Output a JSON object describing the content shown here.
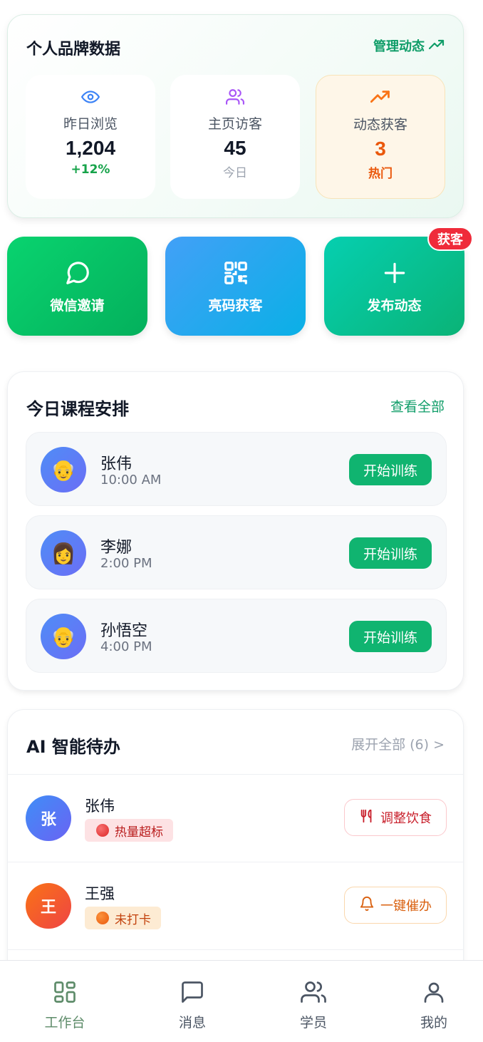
{
  "brand": {
    "title": "个人品牌数据",
    "manage_link": "管理动态",
    "stats": [
      {
        "label": "昨日浏览",
        "value": "1,204",
        "sub": "+12%",
        "icon": "eye-icon"
      },
      {
        "label": "主页访客",
        "value": "45",
        "sub": "今日",
        "icon": "users-icon"
      },
      {
        "label": "动态获客",
        "value": "3",
        "sub": "热门",
        "icon": "trending-up-icon"
      }
    ]
  },
  "actions": [
    {
      "label": "微信邀请",
      "icon": "chat-bubble-icon"
    },
    {
      "label": "亮码获客",
      "icon": "qr-code-icon"
    },
    {
      "label": "发布动态",
      "icon": "plus-icon",
      "badge": "获客"
    }
  ],
  "courses": {
    "title": "今日课程安排",
    "view_all": "查看全部",
    "items": [
      {
        "name": "张伟",
        "time": "10:00 AM",
        "avatar": "👴",
        "button": "开始训练"
      },
      {
        "name": "李娜",
        "time": "2:00 PM",
        "avatar": "👩",
        "button": "开始训练"
      },
      {
        "name": "孙悟空",
        "time": "4:00 PM",
        "avatar": "👴",
        "button": "开始训练"
      }
    ]
  },
  "todos": {
    "title": "AI 智能待办",
    "expand": "展开全部 (6) >",
    "items": [
      {
        "initial": "张",
        "name": "张伟",
        "tag": "热量超标",
        "action": "调整饮食",
        "action_icon": "utensils-icon"
      },
      {
        "initial": "王",
        "name": "王强",
        "tag": "未打卡",
        "action": "一键催办",
        "action_icon": "bell-icon"
      }
    ]
  },
  "tabbar": [
    {
      "label": "工作台",
      "icon": "grid-icon",
      "active": true
    },
    {
      "label": "消息",
      "icon": "message-icon",
      "active": false
    },
    {
      "label": "学员",
      "icon": "users-icon",
      "active": false
    },
    {
      "label": "我的",
      "icon": "user-icon",
      "active": false
    }
  ],
  "colors": {
    "primary_green": "#10b470",
    "brand_green": "#0f9d68",
    "hot_orange": "#ea580c",
    "badge_red": "#ef2b3a",
    "tab_active": "#5e8c6a"
  }
}
